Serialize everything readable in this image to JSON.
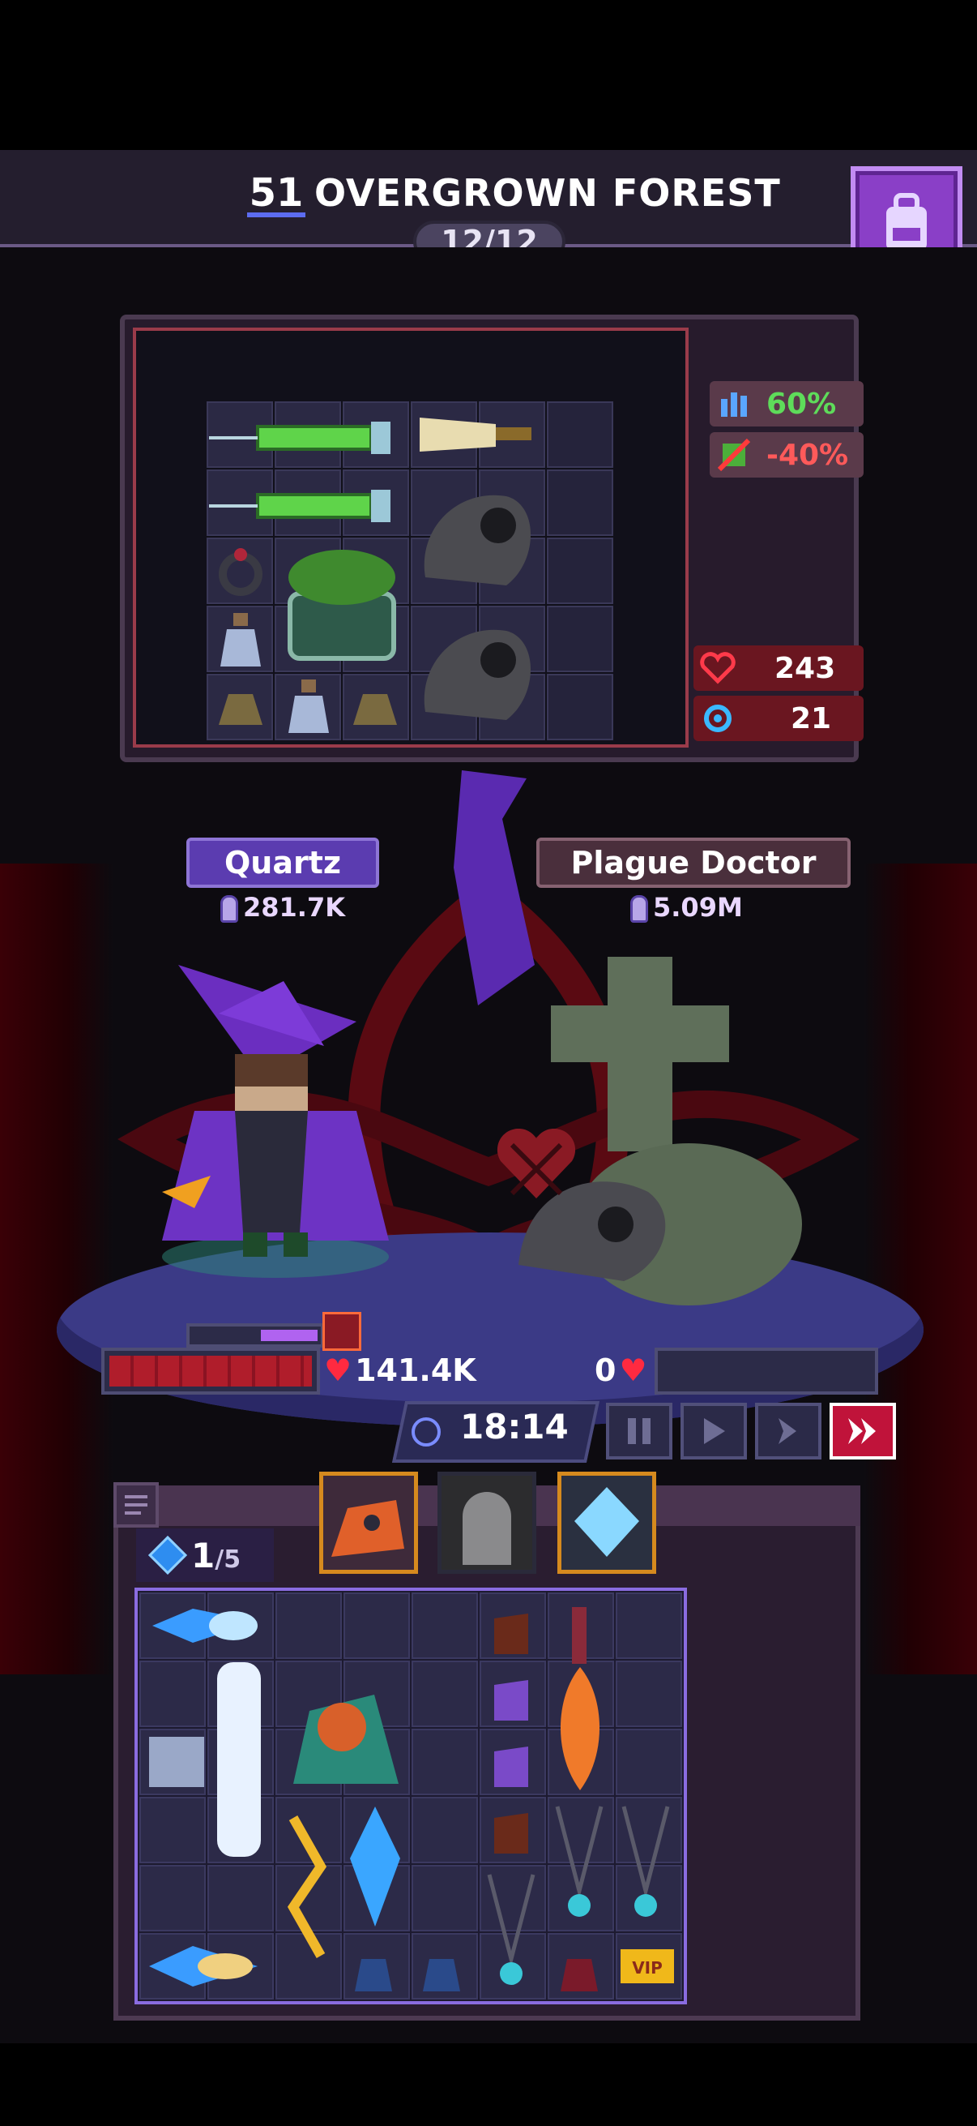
{
  "header": {
    "stage_number": "51",
    "stage_name": "OVERGROWN FOREST",
    "progress": "12/12",
    "backpack_icon": "backpack-icon"
  },
  "stats": {
    "stat1": "60%",
    "stat2": "-40%",
    "health": "243",
    "defense": "21"
  },
  "player": {
    "name": "Quartz",
    "power": "281.7K",
    "hp": "141.4K"
  },
  "enemy": {
    "name": "Plague Doctor",
    "power": "5.09M",
    "hp": "0"
  },
  "battle": {
    "timer": "18:14"
  },
  "stash": {
    "gems_current": "1",
    "gems_max": "/5"
  },
  "colors": {
    "accent_purple": "#8a3fc7",
    "health_red": "#b01d2b",
    "speed_active": "#c0133a"
  }
}
